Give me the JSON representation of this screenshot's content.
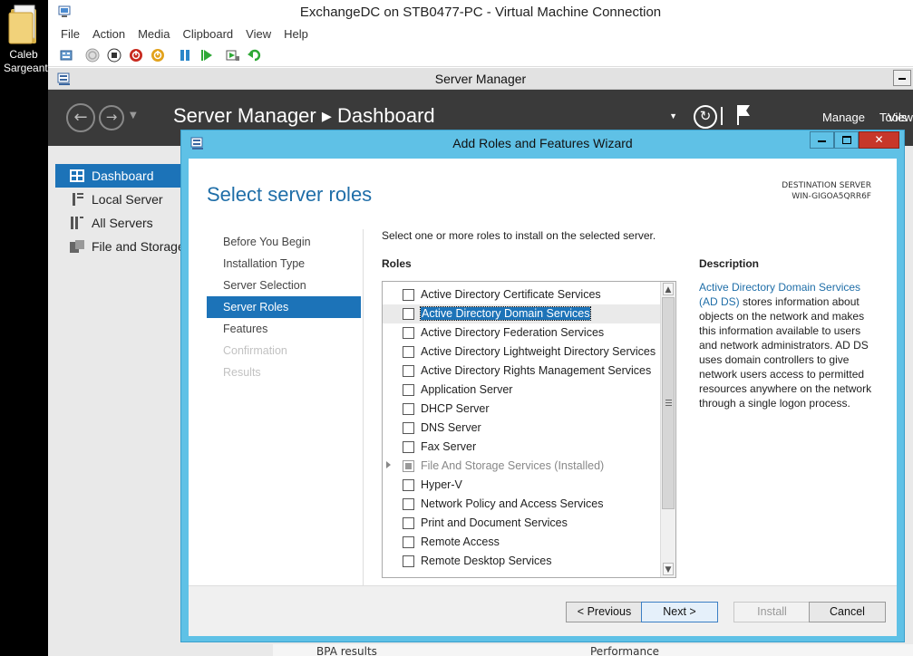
{
  "desktop": {
    "folder_label_1": "Caleb",
    "folder_label_2": "Sargeant"
  },
  "vm": {
    "title": "ExchangeDC on STB0477-PC - Virtual Machine Connection",
    "menu": [
      "File",
      "Action",
      "Media",
      "Clipboard",
      "View",
      "Help"
    ]
  },
  "server_manager": {
    "title": "Server Manager",
    "breadcrumb": "Server Manager ▸ Dashboard",
    "menu": [
      "Manage",
      "Tools",
      "View"
    ],
    "nav": [
      "Dashboard",
      "Local Server",
      "All Servers",
      "File and Storage"
    ],
    "bottom_left": "BPA results",
    "bottom_right": "Performance"
  },
  "wizard": {
    "title": "Add Roles and Features Wizard",
    "heading": "Select server roles",
    "dest_label": "DESTINATION SERVER",
    "dest_server": "WIN-GIGOA5QRR6F",
    "steps": [
      {
        "label": "Before You Begin",
        "state": "normal"
      },
      {
        "label": "Installation Type",
        "state": "normal"
      },
      {
        "label": "Server Selection",
        "state": "normal"
      },
      {
        "label": "Server Roles",
        "state": "active"
      },
      {
        "label": "Features",
        "state": "normal"
      },
      {
        "label": "Confirmation",
        "state": "disabled"
      },
      {
        "label": "Results",
        "state": "disabled"
      }
    ],
    "instruction": "Select one or more roles to install on the selected server.",
    "roles_label": "Roles",
    "roles": [
      {
        "label": "Active Directory Certificate Services",
        "state": "unchecked"
      },
      {
        "label": "Active Directory Domain Services",
        "state": "selected"
      },
      {
        "label": "Active Directory Federation Services",
        "state": "unchecked"
      },
      {
        "label": "Active Directory Lightweight Directory Services",
        "state": "unchecked"
      },
      {
        "label": "Active Directory Rights Management Services",
        "state": "unchecked"
      },
      {
        "label": "Application Server",
        "state": "unchecked"
      },
      {
        "label": "DHCP Server",
        "state": "unchecked"
      },
      {
        "label": "DNS Server",
        "state": "unchecked"
      },
      {
        "label": "Fax Server",
        "state": "unchecked"
      },
      {
        "label": "File And Storage Services (Installed)",
        "state": "installed"
      },
      {
        "label": "Hyper-V",
        "state": "unchecked"
      },
      {
        "label": "Network Policy and Access Services",
        "state": "unchecked"
      },
      {
        "label": "Print and Document Services",
        "state": "unchecked"
      },
      {
        "label": "Remote Access",
        "state": "unchecked"
      },
      {
        "label": "Remote Desktop Services",
        "state": "unchecked"
      }
    ],
    "description_label": "Description",
    "description_link": "Active Directory Domain Services (AD DS)",
    "description_text": " stores information about objects on the network and makes this information available to users and network administrators. AD DS uses domain controllers to give network users access to permitted resources anywhere on the network through a single logon process.",
    "buttons": {
      "previous": "< Previous",
      "next": "Next >",
      "install": "Install",
      "cancel": "Cancel"
    }
  },
  "colors": {
    "accent": "#1c73b8",
    "wizard_frame": "#5fc1e6",
    "heading": "#1f6ea8"
  }
}
